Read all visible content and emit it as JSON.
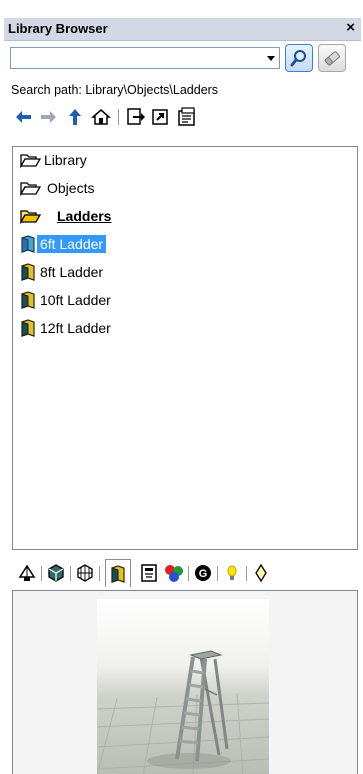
{
  "window": {
    "title": "Library Browser",
    "close_glyph": "×"
  },
  "search": {
    "value": "",
    "placeholder": "",
    "search_icon": "magnifier-icon",
    "clear_icon": "eraser-icon"
  },
  "search_path": "Search path: Library\\Objects\\Ladders",
  "toolbar": {
    "buttons": [
      "back-arrow-icon",
      "forward-arrow-icon",
      "up-arrow-icon",
      "home-icon",
      "import-icon",
      "export-icon",
      "properties-icon"
    ]
  },
  "tree": {
    "items": [
      {
        "label": "Library",
        "icon": "open-folder-icon"
      },
      {
        "label": "Objects",
        "icon": "open-folder-icon"
      },
      {
        "label": "Ladders",
        "icon": "open-folder-yellow-icon"
      },
      {
        "label": "6ft Ladder",
        "icon": "book-icon",
        "selected": true
      },
      {
        "label": "8ft Ladder",
        "icon": "book-icon"
      },
      {
        "label": "10ft Ladder",
        "icon": "book-icon"
      },
      {
        "label": "12ft Ladder",
        "icon": "book-icon"
      }
    ]
  },
  "category_tabs": [
    "light-fixture-icon",
    "geometry-icon",
    "mesh-icon",
    "book-icon",
    "trashcan-icon",
    "materials-icon",
    "material-g-icon",
    "lightbulb-icon",
    "diamond-icon"
  ],
  "active_tab": "book-icon",
  "preview": {
    "subject": "6ft Ladder"
  },
  "colors": {
    "title_bar": "#d3d9e4",
    "selection": "#3399ff",
    "border": "#828790"
  }
}
